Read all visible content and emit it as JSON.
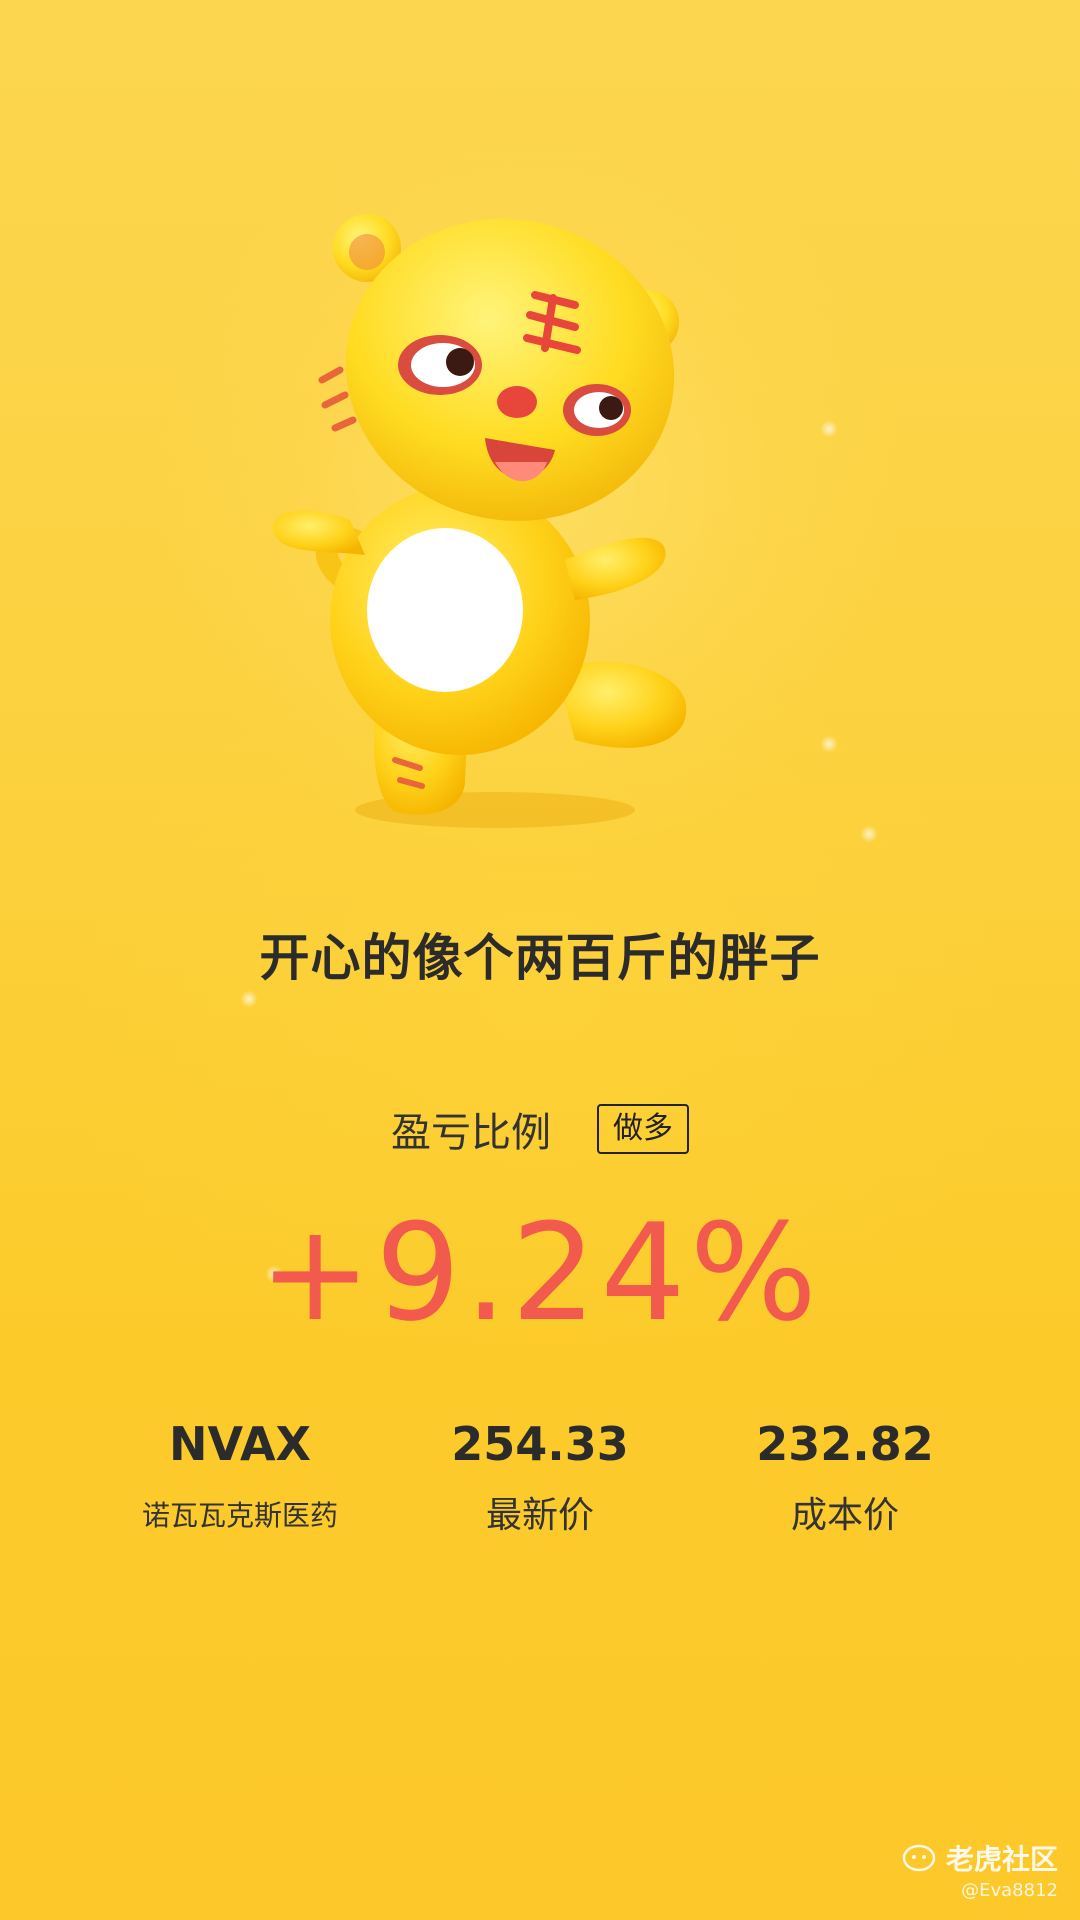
{
  "headline": "开心的像个两百斤的胖子",
  "ratio": {
    "label": "盈亏比例",
    "badge": "做多",
    "value": "+9.24%"
  },
  "stats": [
    {
      "top": "NVAX",
      "bottom": "诺瓦瓦克斯医药"
    },
    {
      "top": "254.33",
      "bottom": "最新价"
    },
    {
      "top": "232.82",
      "bottom": "成本价"
    }
  ],
  "watermark": {
    "brand": "老虎社区",
    "handle": "@Eva8812"
  },
  "colors": {
    "background": "#fcd13e",
    "value": "#f25a4e",
    "text": "#2b2b2b"
  }
}
